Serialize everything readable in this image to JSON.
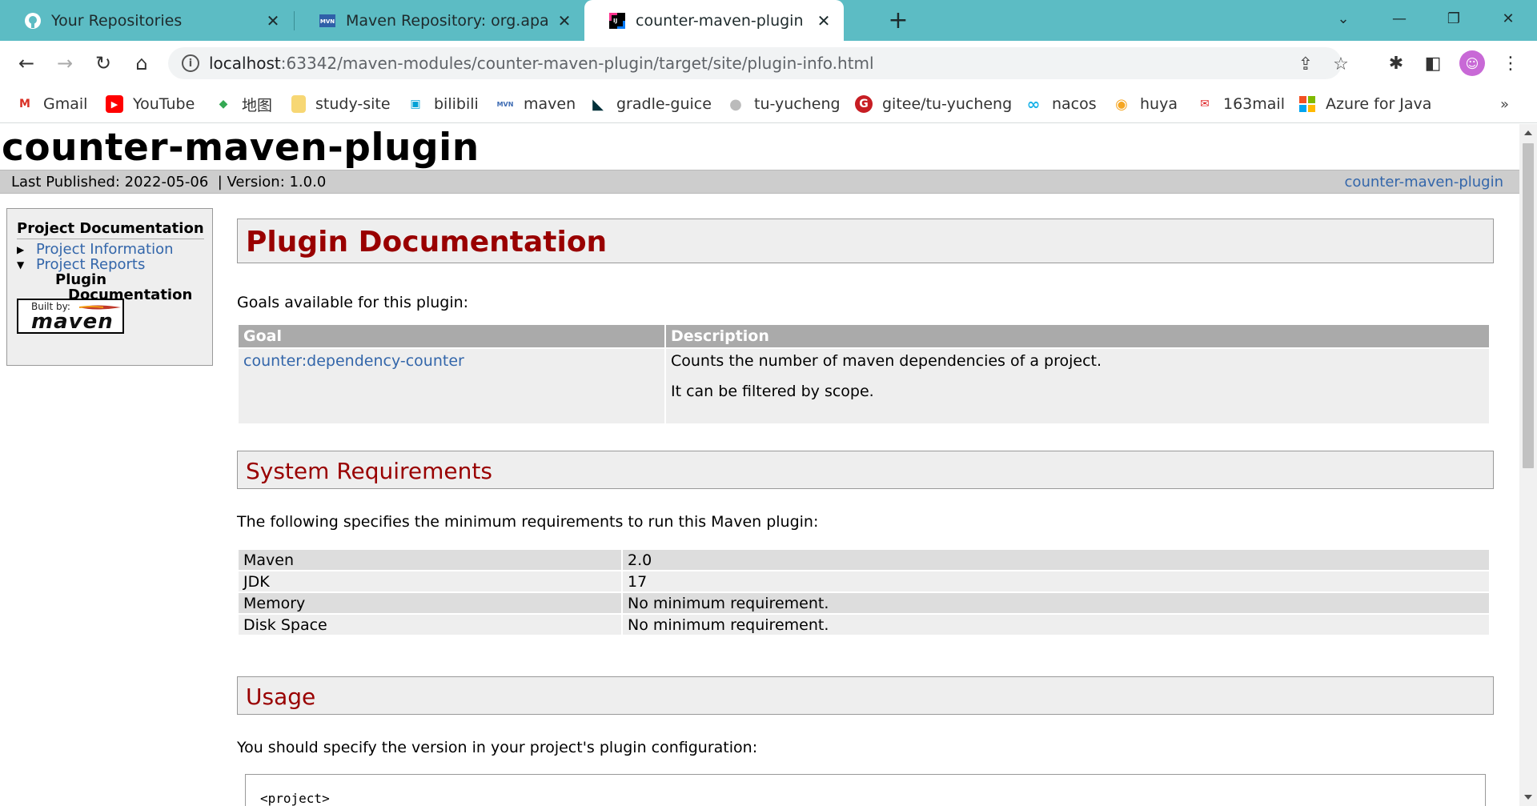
{
  "browser": {
    "tabs": [
      {
        "title": "Your Repositories",
        "icon": "github-icon"
      },
      {
        "title": "Maven Repository: org.apache",
        "icon": "mvn-icon"
      },
      {
        "title": "counter-maven-plugin – Plugi",
        "icon": "intellij-icon",
        "active": true
      }
    ],
    "url_host": "localhost",
    "url_rest": ":63342/maven-modules/counter-maven-plugin/target/site/plugin-info.html",
    "bookmarks": [
      {
        "label": "Gmail",
        "icon": "gmail-icon",
        "color": "#d93025",
        "glyph": "M"
      },
      {
        "label": "YouTube",
        "icon": "youtube-icon",
        "color": "#ff0000",
        "glyph": "▶"
      },
      {
        "label": "地图",
        "icon": "maps-icon",
        "color": "#34a853",
        "glyph": "◆"
      },
      {
        "label": "study-site",
        "icon": "folder-icon",
        "color": "#f7d774",
        "glyph": ""
      },
      {
        "label": "bilibili",
        "icon": "bilibili-icon",
        "color": "#00a1d6",
        "glyph": "▣"
      },
      {
        "label": "maven",
        "icon": "mvn-icon",
        "color": "#3d6bb3",
        "glyph": "MVN"
      },
      {
        "label": "gradle-guice",
        "icon": "gradle-icon",
        "color": "#02303a",
        "glyph": "◣"
      },
      {
        "label": "tu-yucheng",
        "icon": "github-icon",
        "color": "#999999",
        "glyph": "●"
      },
      {
        "label": "gitee/tu-yucheng",
        "icon": "gitee-icon",
        "color": "#c71d23",
        "glyph": "G"
      },
      {
        "label": "nacos",
        "icon": "nacos-icon",
        "color": "#1ab2e8",
        "glyph": "∞"
      },
      {
        "label": "huya",
        "icon": "huya-icon",
        "color": "#f5a623",
        "glyph": "◉"
      },
      {
        "label": "163mail",
        "icon": "mail163-icon",
        "color": "#e0292b",
        "glyph": "✉"
      },
      {
        "label": "Azure for Java",
        "icon": "azure-icon",
        "color": "#f25022",
        "glyph": "▦"
      }
    ]
  },
  "page": {
    "site_title": "counter-maven-plugin",
    "breadcrumb_left": "Last Published: 2022-05-06  | Version: 1.0.0",
    "breadcrumb_right": "counter-maven-plugin",
    "sidebar": {
      "heading": "Project Documentation",
      "items": [
        "Project Information",
        "Project Reports"
      ],
      "current_line1": "Plugin",
      "current_line2": "Documentation",
      "built_by": "Built by:",
      "maven_logo": "maven"
    },
    "heading": "Plugin Documentation",
    "goals_intro": "Goals available for this plugin:",
    "goals_table": {
      "headers": [
        "Goal",
        "Description"
      ],
      "rows": [
        {
          "goal": "counter:dependency-counter",
          "desc1": "Counts the number of maven dependencies of a project.",
          "desc2": "It can be filtered by scope."
        }
      ]
    },
    "system_requirements": {
      "heading": "System Requirements",
      "intro": "The following specifies the minimum requirements to run this Maven plugin:",
      "rows": [
        [
          "Maven",
          "2.0"
        ],
        [
          "JDK",
          "17"
        ],
        [
          "Memory",
          "No minimum requirement."
        ],
        [
          "Disk Space",
          "No minimum requirement."
        ]
      ]
    },
    "usage": {
      "heading": "Usage",
      "intro": "You should specify the version in your project's plugin configuration:",
      "code": "<project>"
    }
  }
}
